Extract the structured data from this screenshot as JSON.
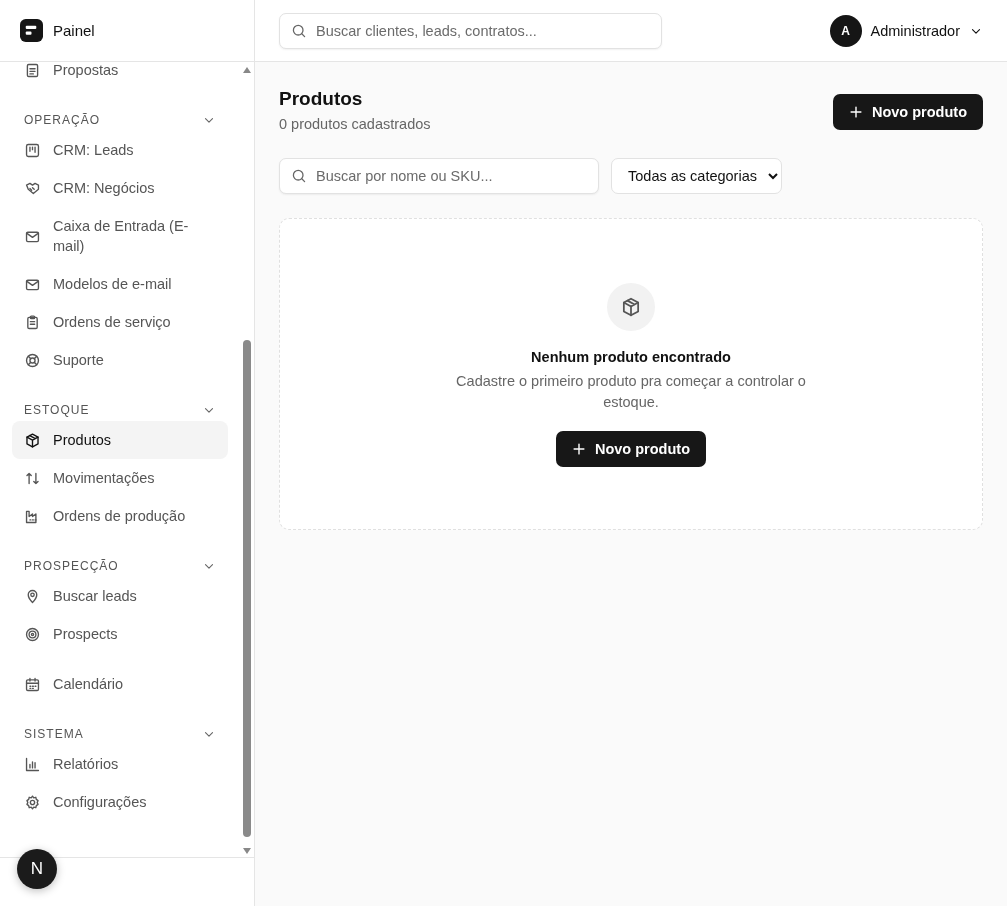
{
  "brand": {
    "name": "Painel"
  },
  "sidebar": {
    "sections": [
      {
        "items": [
          {
            "label": "Propostas",
            "selected": false
          }
        ]
      },
      {
        "title": "OPERAÇÃO",
        "expanded": true,
        "items": [
          {
            "label": "CRM: Leads",
            "selected": false
          },
          {
            "label": "CRM: Negócios",
            "selected": false
          },
          {
            "label": "Caixa de Entrada (E-mail)",
            "selected": false
          },
          {
            "label": "Modelos de e-mail",
            "selected": false
          },
          {
            "label": "Ordens de serviço",
            "selected": false
          },
          {
            "label": "Suporte",
            "selected": false
          }
        ]
      },
      {
        "title": "ESTOQUE",
        "expanded": true,
        "items": [
          {
            "label": "Produtos",
            "selected": true
          },
          {
            "label": "Movimentações",
            "selected": false
          },
          {
            "label": "Ordens de produção",
            "selected": false
          }
        ]
      },
      {
        "title": "PROSPECÇÃO",
        "expanded": true,
        "items": [
          {
            "label": "Buscar leads",
            "selected": false
          },
          {
            "label": "Prospects",
            "selected": false
          }
        ]
      },
      {
        "items": [
          {
            "label": "Calendário",
            "selected": false
          }
        ]
      },
      {
        "title": "SISTEMA",
        "expanded": true,
        "items": [
          {
            "label": "Relatórios",
            "selected": false
          },
          {
            "label": "Configurações",
            "selected": false
          }
        ]
      }
    ],
    "badge": "N"
  },
  "topbar": {
    "search": {
      "placeholder": "Buscar clientes, leads, contratos..."
    },
    "user": {
      "initial": "A",
      "name": "Administrador"
    }
  },
  "page": {
    "title": "Produtos",
    "subtitle": "0 produtos cadastrados",
    "new_button": "Novo produto",
    "search": {
      "placeholder": "Buscar por nome ou SKU..."
    },
    "category_select": "Todas as categorias",
    "empty_state": {
      "title": "Nenhum produto encontrado",
      "text": "Cadastre o primeiro produto pra começar a controlar o estoque.",
      "button": "Novo produto"
    }
  }
}
